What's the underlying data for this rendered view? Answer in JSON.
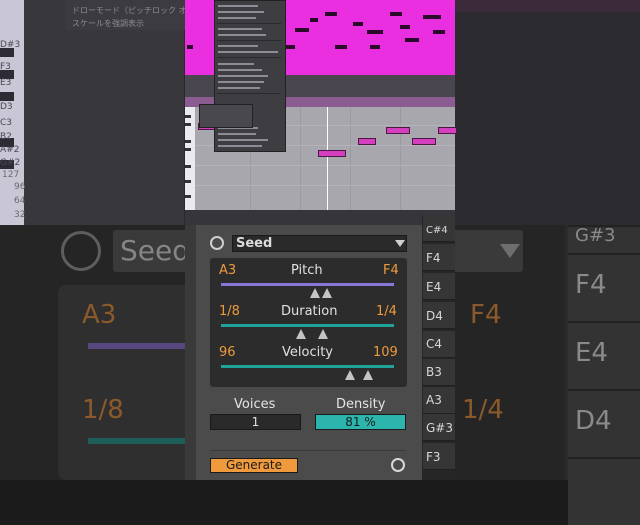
{
  "background": {
    "menu_items": [
      "ドローモード（ピッチロック オン）",
      "スケールを強調表示"
    ],
    "piano_labels": [
      "D#3",
      "F3",
      "E3",
      "D3",
      "C3",
      "B2",
      "A#2",
      "G#2"
    ],
    "velocity_ticks": [
      "127",
      "96",
      "64",
      "32"
    ],
    "zoom_seed": "Seed",
    "zoom_pitch_min": "A3",
    "zoom_pitch_max": "F4",
    "zoom_duration_min": "1/8",
    "zoom_duration_max": "1/4",
    "zoom_notes": [
      "G#3",
      "F4",
      "E4",
      "D4"
    ]
  },
  "device": {
    "seed_label": "Seed",
    "pitch": {
      "title": "Pitch",
      "min": "A3",
      "max": "F4"
    },
    "duration": {
      "title": "Duration",
      "min": "1/8",
      "max": "1/4"
    },
    "velocity": {
      "title": "Velocity",
      "min": "96",
      "max": "109"
    },
    "voices": {
      "label": "Voices",
      "value": "1"
    },
    "density": {
      "label": "Density",
      "value": "81 %"
    },
    "generate_label": "Generate"
  },
  "note_list": [
    "C#4",
    "F4",
    "E4",
    "D4",
    "C4",
    "B3",
    "A3",
    "G#3",
    "F3"
  ],
  "colors": {
    "accent_orange": "#ef9a3c",
    "pitch_bar": "#8a76d8",
    "duration_bar": "#1fa39a",
    "velocity_bar": "#1fa39a",
    "density_fill": "#2bb5ac",
    "clip_pink": "#ea2fe0"
  },
  "icons": {
    "seed_refresh": "refresh-icon",
    "regenerate": "regenerate-icon",
    "dropdown": "chevron-down-icon"
  }
}
